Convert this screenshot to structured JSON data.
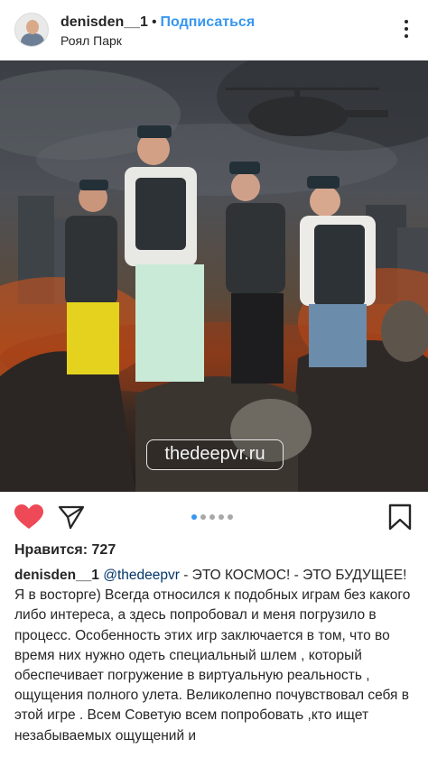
{
  "post": {
    "username": "denisden__1",
    "separator": "•",
    "follow_label": "Подписаться",
    "location": "Роял Парк",
    "watermark": "thedeepvr.ru",
    "carousel": {
      "count": 5,
      "active_index": 0
    },
    "likes_text": "Нравится: 727",
    "caption": {
      "username": "denisden__1",
      "mention": "@thedeepvr",
      "text": " - ЭТО КОСМОС! - ЭТО БУДУЩЕЕ! Я в восторге) Всегда относился к подобных играм без какого либо интереса, а здесь попробовал и меня погрузило в процесс. Особенность этих игр заключается в том, что во время них нужно одеть специальный шлем , который обеспечивает погружение в виртуальную реальность , ощущения полного улета.  Великолепно почувствовал себя в этой игре . Всем Советую всем попробовать ,кто ищет незабываемых ощущений и"
    }
  },
  "icons": {
    "avatar": "avatar",
    "more": "more-vertical-icon",
    "like": "heart-icon",
    "share": "paper-plane-icon",
    "save": "bookmark-icon"
  },
  "colors": {
    "accent": "#3897f0",
    "like": "#ed4956",
    "text": "#262626"
  }
}
